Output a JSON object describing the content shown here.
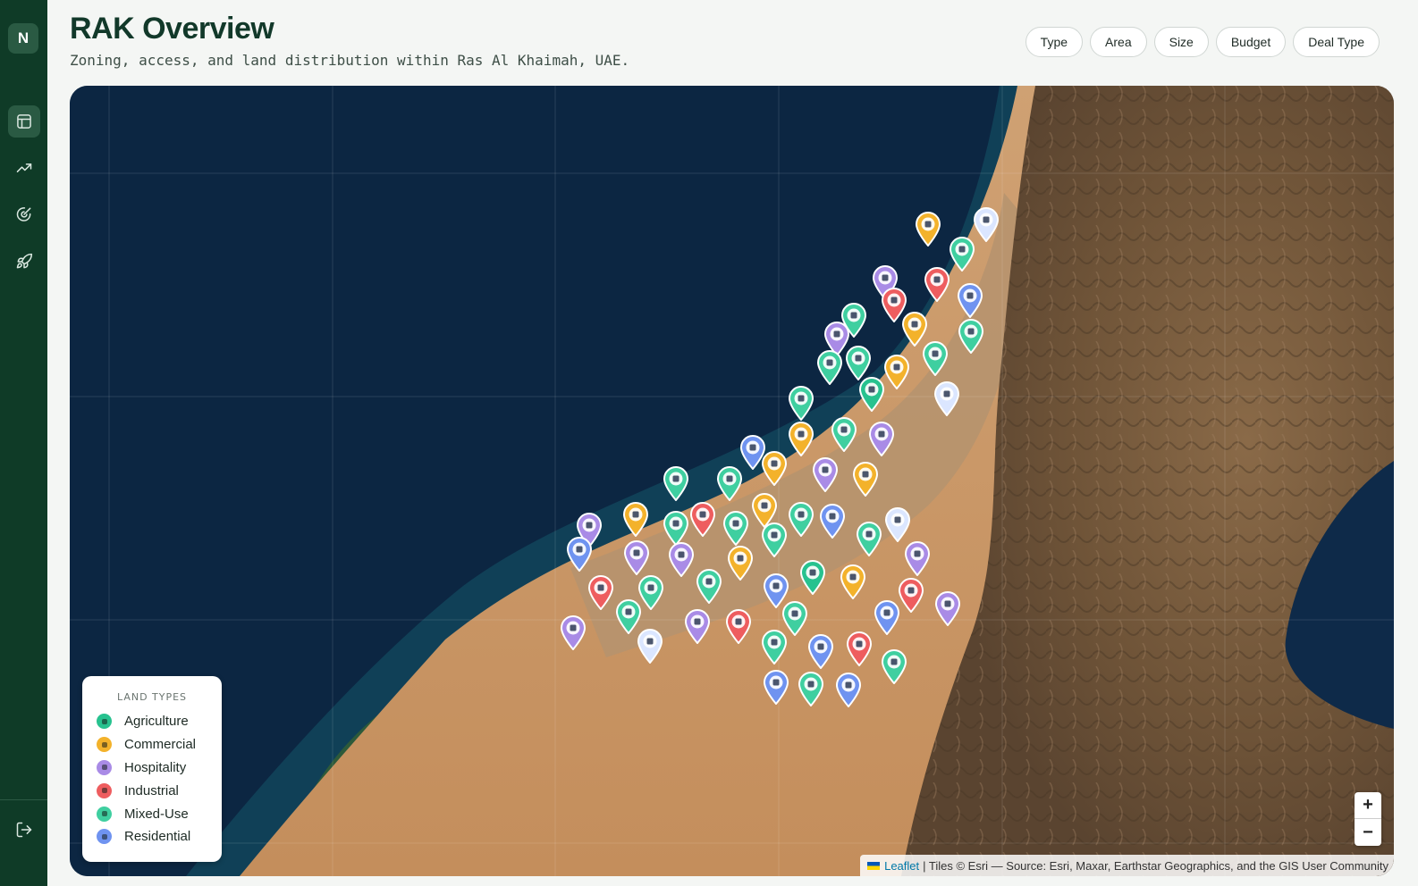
{
  "sidebar": {
    "logo": "N",
    "items": [
      {
        "name": "layout",
        "icon": "layout-icon",
        "active": true
      },
      {
        "name": "trends",
        "icon": "trending-up-icon",
        "active": false
      },
      {
        "name": "target",
        "icon": "target-icon",
        "active": false
      },
      {
        "name": "launch",
        "icon": "rocket-icon",
        "active": false
      }
    ],
    "logout_icon": "logout-icon"
  },
  "header": {
    "title": "RAK Overview",
    "subtitle": "Zoning, access, and land distribution within Ras Al Khaimah, UAE."
  },
  "filters": [
    "Type",
    "Area",
    "Size",
    "Budget",
    "Deal Type"
  ],
  "map": {
    "legend": {
      "title": "LAND TYPES",
      "items": [
        {
          "label": "Agriculture",
          "color": "#27c28f"
        },
        {
          "label": "Commercial",
          "color": "#f3b22b"
        },
        {
          "label": "Hospitality",
          "color": "#a98be6"
        },
        {
          "label": "Industrial",
          "color": "#ee5d5f"
        },
        {
          "label": "Mixed-Use",
          "color": "#3fcfa0"
        },
        {
          "label": "Residential",
          "color": "#6f93f0"
        }
      ]
    },
    "zoom_in": "+",
    "zoom_out": "−",
    "attribution_link": "Leaflet",
    "attribution_text": "| Tiles © Esri — Source: Esri, Maxar, Earthstar Geographics, and the GIS User Community"
  },
  "colors": {
    "sidebar": "#0f3b27",
    "agriculture": "#27c28f",
    "commercial": "#f3b22b",
    "hospitality": "#a98be6",
    "industrial": "#ee5d5f",
    "mixed_use": "#3fcfa0",
    "residential": "#6f93f0",
    "residential_light": "#dbe6ff"
  }
}
